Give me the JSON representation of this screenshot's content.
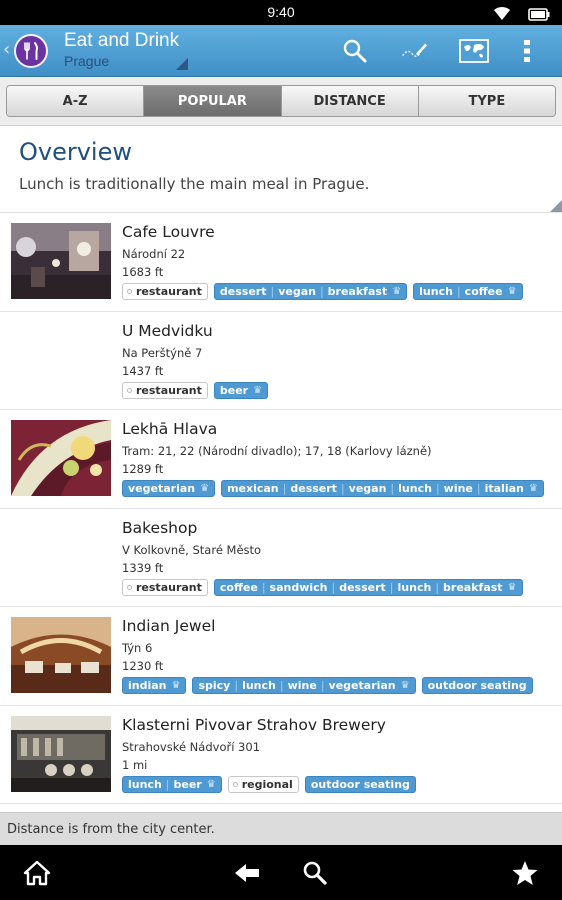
{
  "status": {
    "time": "9:40",
    "icons": [
      "wifi-icon",
      "battery-icon"
    ]
  },
  "actionbar": {
    "title": "Eat and Drink",
    "subtitle": "Prague",
    "icons": [
      "search-icon",
      "edit-icon",
      "map-icon",
      "overflow-menu-icon"
    ]
  },
  "tabs": [
    {
      "label": "A-Z",
      "active": false
    },
    {
      "label": "POPULAR",
      "active": true
    },
    {
      "label": "DISTANCE",
      "active": false
    },
    {
      "label": "TYPE",
      "active": false
    }
  ],
  "overview": {
    "title": "Overview",
    "text": "Lunch is traditionally the main meal in Prague."
  },
  "items": [
    {
      "name": "Cafe Louvre",
      "address": "Národní 22",
      "distance": "1683 ft",
      "tag_plain": "restaurant",
      "tag_group_1": [
        "dessert",
        "vegan",
        "breakfast"
      ],
      "tag_group_2": [
        "lunch",
        "coffee"
      ]
    },
    {
      "name": "U Medvidku",
      "address": "Na Perštýně 7",
      "distance": "1437 ft",
      "tag_plain": "restaurant",
      "tag_group_1": [
        "beer"
      ]
    },
    {
      "name": "Lekhā Hlava",
      "address": "Tram: 21, 22 (Národní divadlo); 17, 18 (Karlovy lázně)",
      "distance": "1289 ft",
      "tag_group_1": [
        "vegetarian"
      ],
      "tag_group_2": [
        "mexican",
        "dessert",
        "vegan",
        "lunch",
        "wine",
        "italian"
      ]
    },
    {
      "name": "Bakeshop",
      "address": "V Kolkovně, Staré Město",
      "distance": "1339 ft",
      "tag_plain": "restaurant",
      "tag_group_1": [
        "coffee",
        "sandwich",
        "dessert",
        "lunch",
        "breakfast"
      ]
    },
    {
      "name": "Indian Jewel",
      "address": "Týn 6",
      "distance": "1230 ft",
      "tag_group_1": [
        "indian"
      ],
      "tag_group_2": [
        "spicy",
        "lunch",
        "wine",
        "vegetarian"
      ],
      "tag_group_3": [
        "outdoor seating"
      ]
    },
    {
      "name": "Klasterni Pivovar Strahov Brewery",
      "address": "Strahovské Nádvoří  301",
      "distance": "1 mi",
      "tag_group_1": [
        "lunch",
        "beer"
      ],
      "tag_plain": "regional",
      "tag_group_3": [
        "outdoor seating"
      ]
    }
  ],
  "footer": {
    "note": "Distance is from the city center."
  },
  "navbar": {
    "icons": [
      "home-icon",
      "back-icon",
      "search-icon",
      "favorites-star-icon"
    ]
  },
  "colors": {
    "actionbar": "#4f9fd4",
    "tag_blue": "#4f9ad3",
    "title_blue": "#21507c",
    "app_icon": "#6a33a0"
  }
}
